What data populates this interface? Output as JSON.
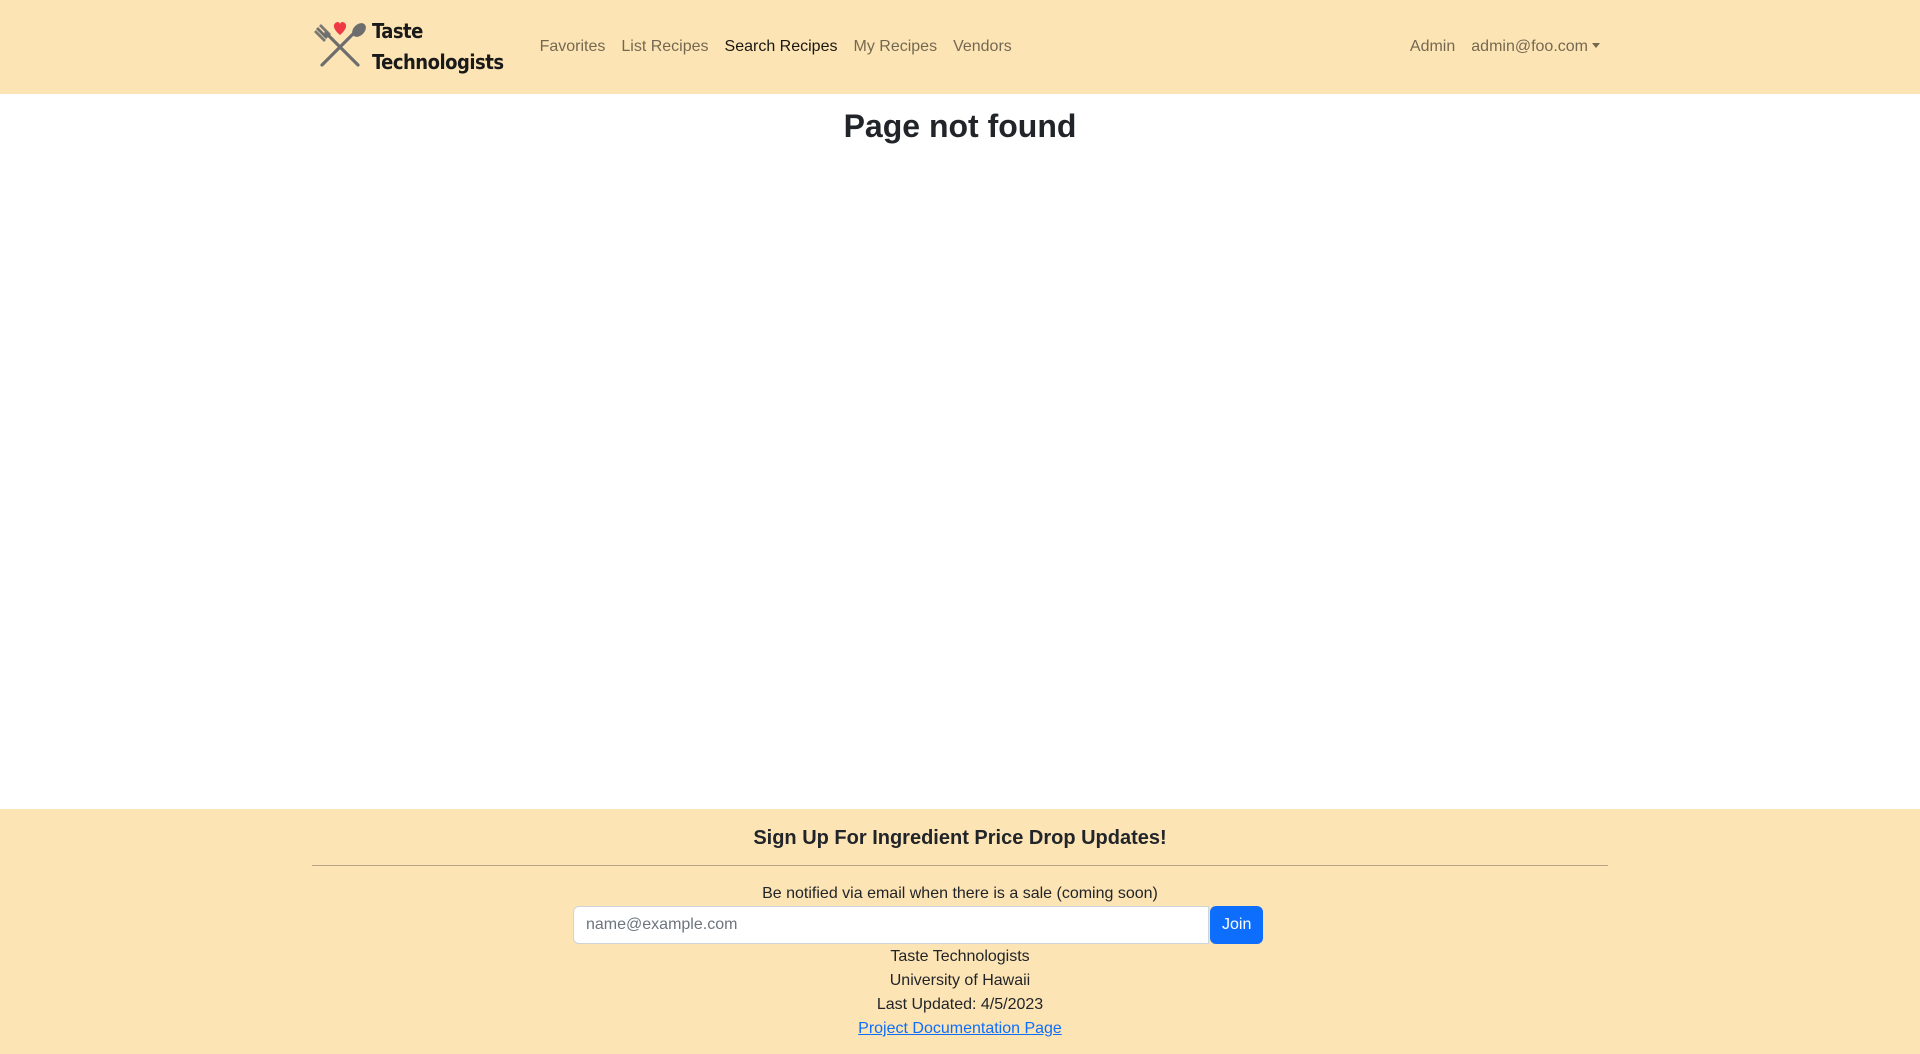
{
  "brand": {
    "line1": "Taste",
    "line2": "Technologists",
    "heart_color": "#ee3a45",
    "utensil_color": "#6d6d6d"
  },
  "nav": {
    "items": [
      {
        "label": "Favorites",
        "active": false
      },
      {
        "label": "List Recipes",
        "active": false
      },
      {
        "label": "Search Recipes",
        "active": true
      },
      {
        "label": "My Recipes",
        "active": false
      },
      {
        "label": "Vendors",
        "active": false
      }
    ],
    "admin_label": "Admin",
    "user_label": "admin@foo.com"
  },
  "main": {
    "title": "Page not found"
  },
  "footer": {
    "heading": "Sign Up For Ingredient Price Drop Updates!",
    "note": "Be notified via email when there is a sale (coming soon)",
    "email_placeholder": "name@example.com",
    "join_label": "Join",
    "org": "Taste Technologists",
    "school": "University of Hawaii",
    "updated": "Last Updated: 4/5/2023",
    "doc_link": "Project Documentation Page"
  },
  "colors": {
    "navbar_bg": "#fde4b4",
    "footer_bg": "#fde4b4",
    "primary": "#0d6efd"
  }
}
